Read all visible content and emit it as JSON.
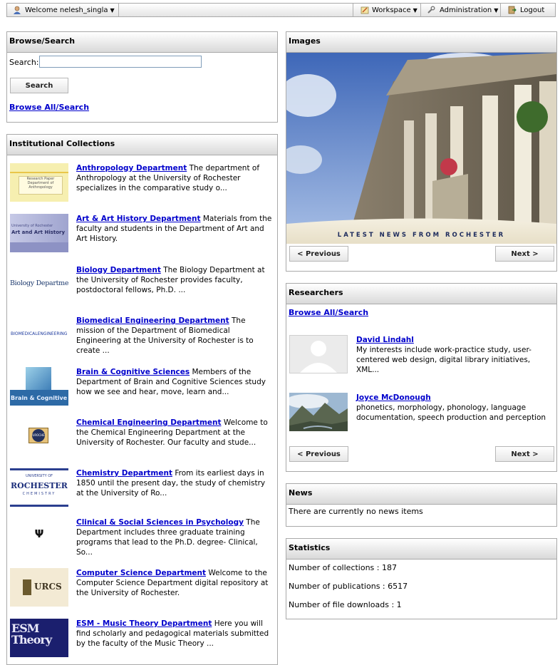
{
  "topbar": {
    "welcome": "Welcome nelesh_singla",
    "workspace": "Workspace",
    "administration": "Administration",
    "logout": "Logout"
  },
  "browse": {
    "title": "Browse/Search",
    "search_label": "Search:",
    "search_value": "",
    "search_button": "Search",
    "browse_all": "Browse All/Search"
  },
  "collections": {
    "title": "Institutional Collections",
    "items": [
      {
        "name": "Anthropology Department",
        "desc": "The department of Anthropology at the University of Rochester specializes in the comparative study o..."
      },
      {
        "name": "Art & Art History Department",
        "desc": "Materials from the faculty and students in the Department of Art and Art History."
      },
      {
        "name": "Biology Department",
        "desc": "The Biology Department at the University of Rochester provides faculty, postdoctoral fellows, Ph.D. ..."
      },
      {
        "name": "Biomedical Engineering Department",
        "desc": "The mission of the Department of Biomedical Engineering at the University of Rochester is to create ..."
      },
      {
        "name": "Brain & Cognitive Sciences",
        "desc": "Members of the Department of Brain and Cognitive Sciences study how we see and hear, move, learn and..."
      },
      {
        "name": "Chemical Engineering Department",
        "desc": "Welcome to the Chemical Engineering Department at the University of Rochester. Our faculty and stude..."
      },
      {
        "name": "Chemistry Department",
        "desc": "From its earliest days in 1850 until the present day, the study of chemistry at the University of Ro..."
      },
      {
        "name": "Clinical & Social Sciences in Psychology",
        "desc": "The Department includes three graduate training programs that lead to the Ph.D. degree- Clinical, So..."
      },
      {
        "name": "Computer Science Department",
        "desc": "Welcome to the Computer Science Department digital repository at the University of Rochester."
      },
      {
        "name": "ESM - Music Theory Department",
        "desc": "Here you will find scholarly and pedagogical materials submitted by the faculty of the Music Theory ..."
      }
    ],
    "thumb_text": {
      "anthro": "Research Paper\nDepartment of\nAnthropology",
      "art": "Art and Art History",
      "art_top": "University of Rochester",
      "biology": "Biology Department",
      "biomed": "BIOMEDICALENGINEERING",
      "brain": "Brain & Cognitive Sciences",
      "chemeng": "UROCHE",
      "chem_top": "UNIVERSITY OF",
      "chem": "ROCHESTER",
      "chem_bottom": "CHEMISTRY",
      "psych": "Ψ",
      "urcs": "URCS",
      "esm": "ESM Theory"
    }
  },
  "images": {
    "title": "Images",
    "banner": "LATEST NEWS FROM ROCHESTER",
    "prev": "< Previous",
    "next": "Next >"
  },
  "researchers": {
    "title": "Researchers",
    "browse_all": "Browse All/Search",
    "items": [
      {
        "name": "David Lindahl",
        "desc": "My interests include work-practice study, user-centered web design, digital library initiatives, XML..."
      },
      {
        "name": "Joyce McDonough",
        "desc": "phonetics, morphology, phonology, language documentation, speech production and perception"
      }
    ],
    "prev": "< Previous",
    "next": "Next >"
  },
  "news": {
    "title": "News",
    "text": "There are currently no news items"
  },
  "statistics": {
    "title": "Statistics",
    "collections": "Number of collections : 187",
    "publications": "Number of publications : 6517",
    "downloads": "Number of file downloads : 1"
  }
}
